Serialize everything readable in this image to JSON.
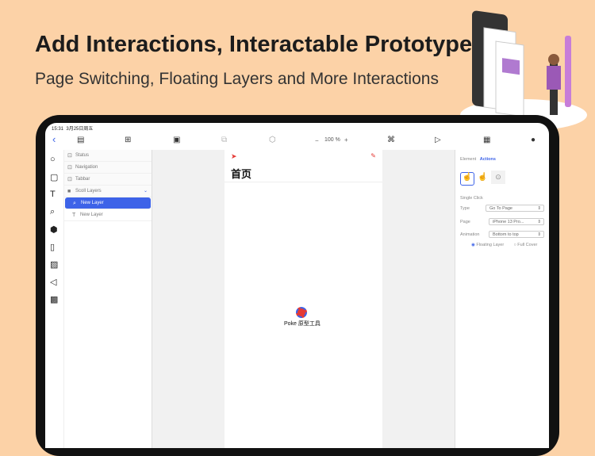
{
  "headline": "Add Interactions, Interactable Prototype",
  "subheadline": "Page Switching, Floating Layers and More Interactions",
  "status": {
    "time": "15:31",
    "date": "3月25日周五"
  },
  "toolbar": {
    "zoom": "100 %",
    "zoom_out": "−",
    "zoom_in": "+"
  },
  "layers": [
    {
      "label": "Status",
      "icon": "⊡"
    },
    {
      "label": "Navigation",
      "icon": "⊡"
    },
    {
      "label": "Tabbar",
      "icon": "⊡"
    },
    {
      "label": "Scoll Layers",
      "icon": "■"
    },
    {
      "label": "New Layer",
      "icon": "⌕"
    },
    {
      "label": "New Layer",
      "icon": "T"
    }
  ],
  "page": {
    "title": "首页",
    "logo_text": "Poke 原型工具"
  },
  "panel": {
    "tab_element": "Element",
    "tab_actions": "Actions",
    "section": "Single Click",
    "type_label": "Type",
    "type_value": "Go To Page",
    "page_label": "Page",
    "page_value": "iPhone 13 Pro...",
    "anim_label": "Animation",
    "anim_value": "Bottom to top",
    "opt1": "Floating Layer",
    "opt2": "Full Cover"
  },
  "colors": {
    "accent": "#3d63e8",
    "background": "#fcd2a7"
  }
}
